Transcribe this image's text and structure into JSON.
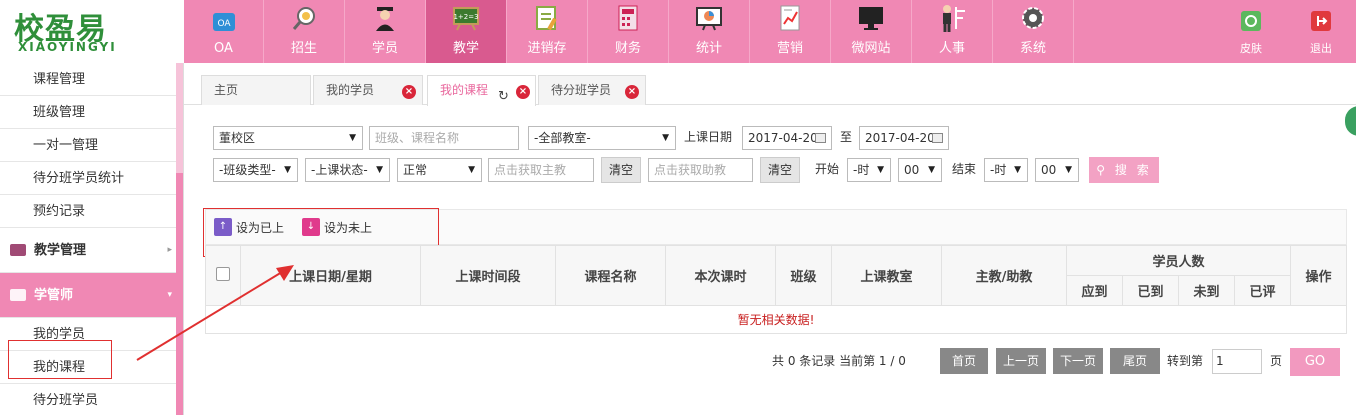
{
  "logo": {
    "cn": "校盈易",
    "en": "XIAOYINGYI"
  },
  "nav": {
    "items": [
      {
        "label": "OA",
        "icon": "oa-icon"
      },
      {
        "label": "招生",
        "icon": "recruit-icon"
      },
      {
        "label": "学员",
        "icon": "student-icon"
      },
      {
        "label": "教学",
        "icon": "teaching-icon"
      },
      {
        "label": "进销存",
        "icon": "inventory-icon"
      },
      {
        "label": "财务",
        "icon": "finance-icon"
      },
      {
        "label": "统计",
        "icon": "statistics-icon"
      },
      {
        "label": "营销",
        "icon": "marketing-icon"
      },
      {
        "label": "微网站",
        "icon": "website-icon"
      },
      {
        "label": "人事",
        "icon": "hr-icon"
      },
      {
        "label": "系统",
        "icon": "system-icon"
      }
    ],
    "active": "教学",
    "skin": "皮肤",
    "logout": "退出"
  },
  "sidebar": {
    "top_items": [
      "课程管理",
      "班级管理",
      "一对一管理",
      "待分班学员统计",
      "预约记录"
    ],
    "section_teaching": "教学管理",
    "section_counselor": "学管师",
    "sub_items": [
      "我的学员",
      "我的课程",
      "待分班学员"
    ]
  },
  "tabs": [
    {
      "label": "主页"
    },
    {
      "label": "我的学员"
    },
    {
      "label": "我的课程"
    },
    {
      "label": "待分班学员"
    }
  ],
  "filters": {
    "campus": "董校区",
    "class_course_placeholder": "班级、课程名称",
    "classroom": "-全部教室-",
    "date_label": "上课日期",
    "date_from": "2017-04-20",
    "to_label": "至",
    "date_to": "2017-04-20",
    "class_type": "-班级类型-",
    "class_status": "-上课状态-",
    "normal": "正常",
    "main_teacher_placeholder": "点击获取主教",
    "clear1": "清空",
    "assistant_placeholder": "点击获取助教",
    "clear2": "清空",
    "start_label": "开始",
    "start_hour": "-时",
    "start_min": "00",
    "end_label": "结束",
    "end_hour": "-时",
    "end_min": "00",
    "search": "搜 索"
  },
  "actions": {
    "set_attended": "设为已上",
    "set_not_attended": "设为未上"
  },
  "table": {
    "headers": [
      "上课日期/星期",
      "上课时间段",
      "课程名称",
      "本次课时",
      "班级",
      "上课教室",
      "主教/助教",
      "学员人数",
      "操作"
    ],
    "sub_headers": [
      "应到",
      "已到",
      "未到",
      "已评"
    ],
    "empty": "暂无相关数据!"
  },
  "pager": {
    "info": "共 0 条记录 当前第 1 / 0",
    "first": "首页",
    "prev": "上一页",
    "next": "下一页",
    "last": "尾页",
    "goto": "转到第",
    "page_input": "1",
    "page_unit": "页",
    "go": "GO"
  },
  "colors": {
    "brand_pink": "#f088b4",
    "active_nav": "#d95a8f",
    "logo_green": "#2f8f3a",
    "empty_red": "#c81e1e"
  }
}
